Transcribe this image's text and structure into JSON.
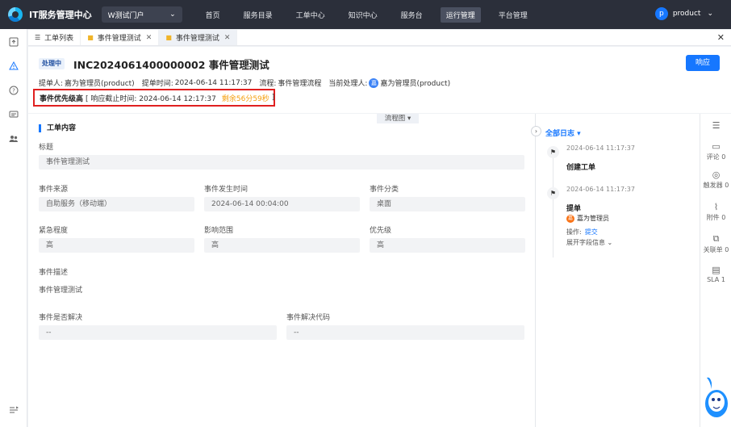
{
  "topbar": {
    "app_title": "IT服务管理中心",
    "portal": "W测试门户",
    "nav": [
      "首页",
      "服务目录",
      "工单中心",
      "知识中心",
      "服务台",
      "运行管理",
      "平台管理"
    ],
    "active_nav": "运行管理",
    "user_initial": "p",
    "user_name": "product"
  },
  "tabs": [
    {
      "label": "工单列表",
      "icon": "list-icon",
      "closable": false
    },
    {
      "label": "事件管理测试",
      "icon": "folder-icon",
      "closable": true
    },
    {
      "label": "事件管理测试",
      "icon": "folder-icon",
      "closable": true,
      "active": true
    }
  ],
  "header": {
    "status": "处理中",
    "ticket_title": "INC2024061400000002 事件管理测试",
    "respond_label": "响应",
    "submitter_label": "提单人:",
    "submitter": "嘉为管理员(product)",
    "submit_time_label": "提单时间:",
    "submit_time": "2024-06-14 11:17:37",
    "flow_label": "流程:",
    "flow": "事件管理流程",
    "handler_label": "当前处理人:",
    "handler_initial": "嘉",
    "handler": "嘉为管理员(product)",
    "priority_label": "事件优先级高",
    "deadline_text": "[ 响应截止时间:  2024-06-14 12:17:37",
    "remaining": "剩余56分59秒",
    "bracket_close": "]"
  },
  "main": {
    "flowchart_tab": "流程图 ▾",
    "section_title": "工单内容",
    "title_label": "标题",
    "title_value": "事件管理测试",
    "source_label": "事件来源",
    "source_value": "自助服务（移动端）",
    "occur_label": "事件发生时间",
    "occur_value": "2024-06-14 00:04:00",
    "category_label": "事件分类",
    "category_value": "桌面",
    "urgency_label": "紧急程度",
    "urgency_value": "高",
    "impact_label": "影响范围",
    "impact_value": "高",
    "priority_label": "优先级",
    "priority_value": "高",
    "desc_label": "事件描述",
    "desc_value": "事件管理测试",
    "resolved_label": "事件是否解决",
    "resolved_value": "--",
    "resolve_code_label": "事件解决代码",
    "resolve_code_value": "--"
  },
  "timeline": {
    "title": "全部日志 ▾",
    "entries": [
      {
        "time": "2024-06-14 11:17:37",
        "event": "创建工单"
      },
      {
        "time": "2024-06-14 11:17:37",
        "event": "提单",
        "user_initial": "嘉",
        "user": "嘉为管理员",
        "op_label": "操作:",
        "op_value": "提交",
        "expand": "展开字段信息 ⌄"
      }
    ]
  },
  "right_rail": [
    {
      "label": "",
      "icon": "collapse-list-icon"
    },
    {
      "label": "评论 0",
      "icon": "comment-icon"
    },
    {
      "label": "触发器 0",
      "icon": "trigger-icon"
    },
    {
      "label": "附件 0",
      "icon": "attachment-icon"
    },
    {
      "label": "关联单 0",
      "icon": "link-ticket-icon"
    },
    {
      "label": "SLA 1",
      "icon": "sla-icon"
    }
  ],
  "colors": {
    "primary": "#1677ff",
    "topbar": "#2b2f3a",
    "warning": "#f59e0b",
    "highlight_border": "#e02020"
  }
}
